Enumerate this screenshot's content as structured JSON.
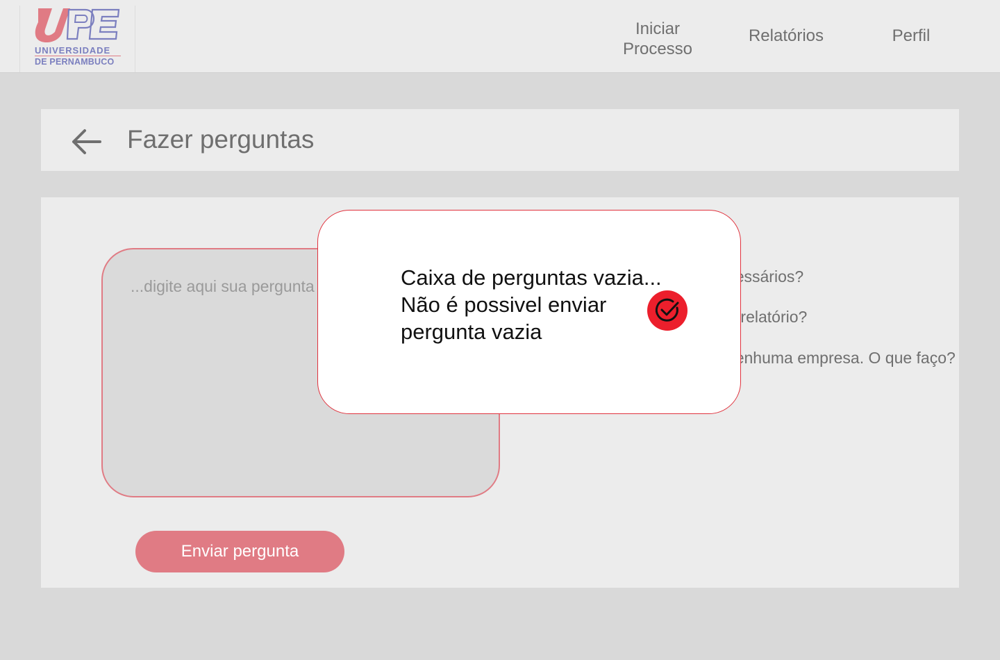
{
  "header": {
    "logo": {
      "mark": "UPE",
      "line1": "UNIVERSIDADE",
      "line2": "DE PERNAMBUCO"
    },
    "nav": {
      "iniciar_line1": "Iniciar",
      "iniciar_line2": "Processo",
      "relatorios": "Relatórios",
      "perfil": "Perfil"
    }
  },
  "page": {
    "title": "Fazer perguntas"
  },
  "form": {
    "placeholder": "...digite aqui sua pergunta",
    "value": "",
    "send_label": "Enviar pergunta"
  },
  "faq": {
    "items": [
      "Quais documentos são necessários?",
      "Qual o prazo de entrega do relatório?",
      "Não consegui estágio em nenhuma empresa. O que faço?"
    ]
  },
  "modal": {
    "line1": "Caixa de perguntas vazia...",
    "line2": "Não é possivel enviar",
    "line3": "pergunta vazia"
  },
  "colors": {
    "accent": "#e07b84",
    "alert": "#e0313c",
    "logo_blue": "#7b7fbf",
    "text_gray": "#6f6f6f"
  }
}
